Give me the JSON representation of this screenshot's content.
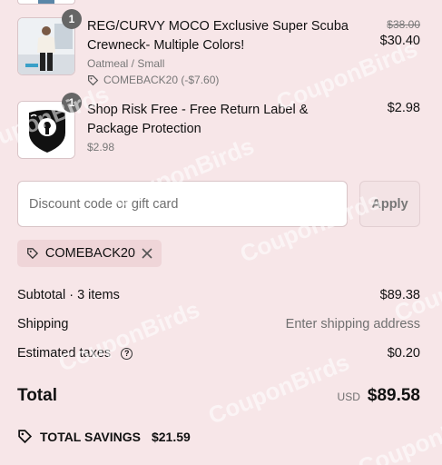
{
  "cart": {
    "items": [
      {
        "quantity": "1",
        "title": "REG/CURVY MOCO Exclusive Super Scuba Crewneck- Multiple Colors!",
        "variant": "Oatmeal / Small",
        "discount": "COMEBACK20 (-$7.60)",
        "original_price": "$38.00",
        "price": "$30.40",
        "image_icon": "product-photo-model"
      },
      {
        "quantity": "1",
        "title": "Shop Risk Free - Free Return Label & Package Protection",
        "variant": "$2.98",
        "price": "$2.98",
        "image_icon": "shield-keyhole-logo"
      }
    ]
  },
  "discount": {
    "placeholder": "Discount code or gift card",
    "apply_label": "Apply",
    "applied_code": "COMEBACK20"
  },
  "summary": {
    "subtotal_label": "Subtotal · 3 items",
    "subtotal_value": "$89.38",
    "shipping_label": "Shipping",
    "shipping_value": "Enter shipping address",
    "taxes_label": "Estimated taxes",
    "taxes_value": "$0.20",
    "total_label": "Total",
    "currency": "USD",
    "total_value": "$89.58",
    "savings_label": "TOTAL SAVINGS",
    "savings_value": "$21.59"
  },
  "watermark": "CouponBirds",
  "colors": {
    "background": "#f7e6e8",
    "badge": "#666666",
    "chip": "#efd5d8"
  }
}
